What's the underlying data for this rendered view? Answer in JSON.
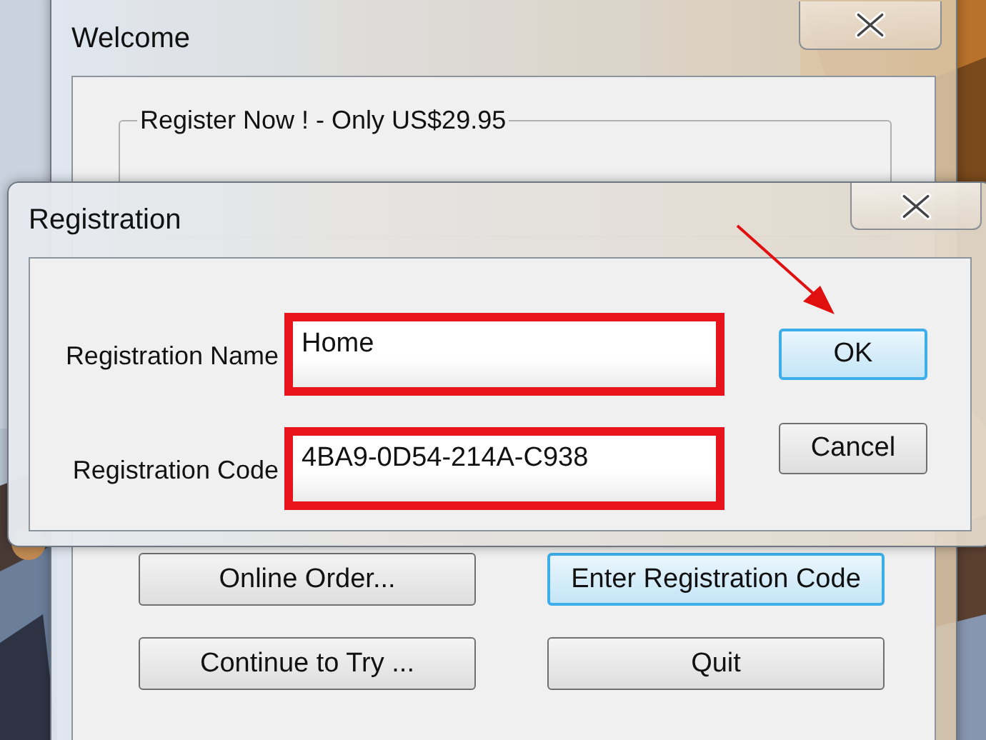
{
  "welcome": {
    "title": "Welcome",
    "group_title": "Register Now ! - Only US$29.95",
    "buttons": [
      {
        "label": "Online Order...",
        "focused": false
      },
      {
        "label": "Enter Registration Code",
        "focused": true
      },
      {
        "label": "Continue to Try ...",
        "focused": false
      },
      {
        "label": "Quit",
        "focused": false
      }
    ]
  },
  "registration": {
    "title": "Registration",
    "fields": [
      {
        "label": "Registration Name",
        "value": "Home",
        "highlighted": true
      },
      {
        "label": "Registration Code",
        "value": "4BA9-0D54-214A-C938",
        "highlighted": true
      }
    ],
    "buttons": [
      {
        "label": "OK",
        "focused": true
      },
      {
        "label": "Cancel",
        "focused": false
      }
    ]
  }
}
